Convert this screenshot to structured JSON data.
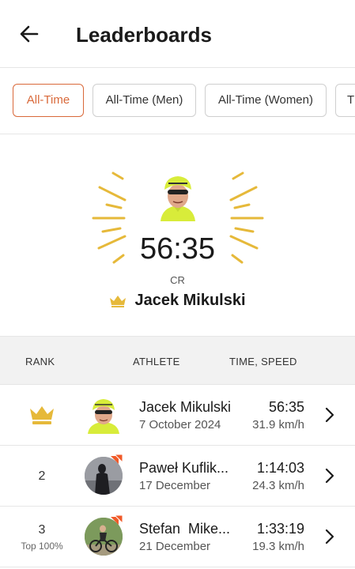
{
  "header": {
    "title": "Leaderboards",
    "back_icon": "arrow-left-icon"
  },
  "filters": [
    {
      "label": "All-Time",
      "active": true
    },
    {
      "label": "All-Time (Men)",
      "active": false
    },
    {
      "label": "All-Time (Women)",
      "active": false
    },
    {
      "label": "T",
      "active": false
    }
  ],
  "hero": {
    "time": "56:35",
    "caption": "CR",
    "name": "Jacek Mikulski",
    "crown_icon": "crown-icon",
    "ray_color": "#e6b93a"
  },
  "table": {
    "headers": {
      "rank": "RANK",
      "athlete": "ATHLETE",
      "time_speed": "TIME, SPEED"
    },
    "rows": [
      {
        "rank": "",
        "rank_icon": "crown-icon",
        "rank_sub": "",
        "name": "Jacek Mikulski",
        "date": "7 October 2024",
        "time": "56:35",
        "speed": "31.9 km/h"
      },
      {
        "rank": "2",
        "rank_sub": "",
        "name": "Paweł Kuflik...",
        "date": "17 December",
        "time": "1:14:03",
        "speed": "24.3 km/h"
      },
      {
        "rank": "3",
        "rank_sub": "Top 100%",
        "name": "Stefan  Mike...",
        "date": "21 December",
        "time": "1:33:19",
        "speed": "19.3 km/h"
      }
    ]
  },
  "colors": {
    "accent": "#d9693a",
    "gold": "#e6b93a",
    "badge": "#f05a28"
  }
}
